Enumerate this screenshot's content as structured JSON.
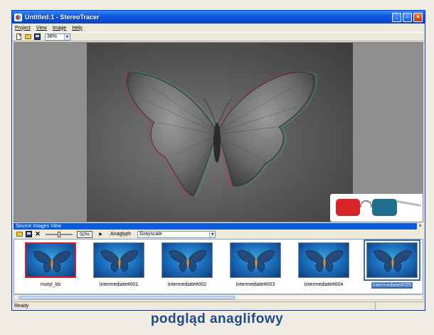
{
  "window": {
    "title": "Untitled:1 - StereoTracer"
  },
  "menu": {
    "items": [
      "Project",
      "View",
      "Image",
      "Help"
    ]
  },
  "toolbar": {
    "zoom": "38%"
  },
  "source_panel": {
    "title": "Source Images View",
    "zoom_percent": "50%",
    "mode_label": "Anaglyph",
    "mode_value": "Grayscale"
  },
  "thumbnails": [
    {
      "label": "motyl_kb"
    },
    {
      "label": "Intermediate#001"
    },
    {
      "label": "Intermediate#002"
    },
    {
      "label": "Intermediate#003"
    },
    {
      "label": "Intermediate#004"
    },
    {
      "label": "Intermediate#005"
    }
  ],
  "status": {
    "text": "Ready"
  },
  "caption": "podgląd anaglifowy",
  "colors": {
    "lens_left": "#d8232a",
    "lens_right": "#1f6f8d",
    "caption": "#1f4a85",
    "titlebar": "#0a5ade"
  }
}
